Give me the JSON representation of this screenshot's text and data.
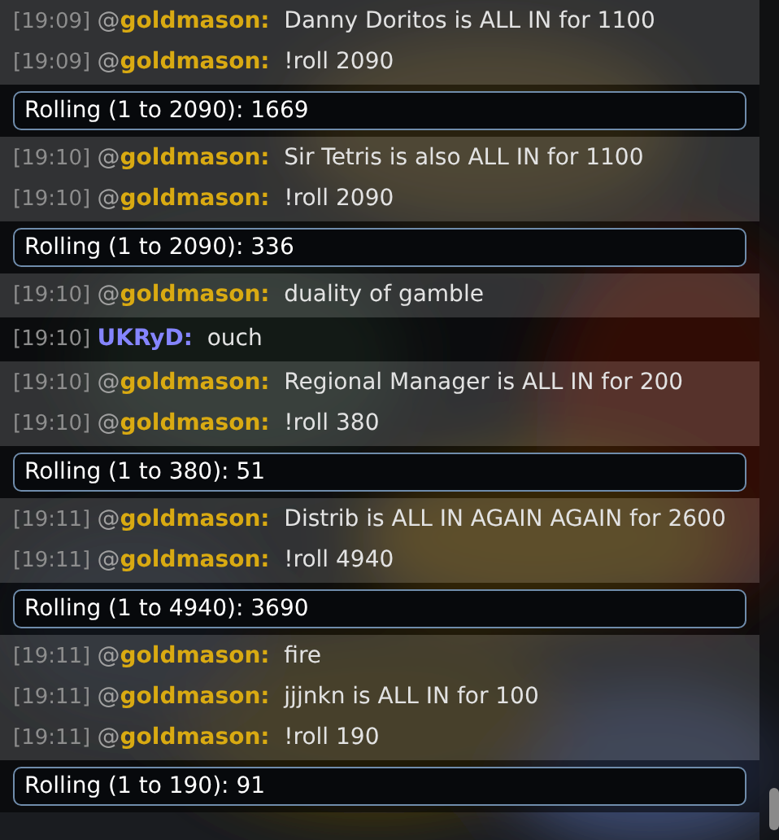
{
  "blocks": [
    {
      "kind": "group",
      "messages": [
        {
          "time": "[19:09]",
          "prefix": "@",
          "user": "goldmason:",
          "color": "#d9aa12",
          "text": "Danny Doritos is ALL IN for 1100"
        },
        {
          "time": "[19:09]",
          "prefix": "@",
          "user": "goldmason:",
          "color": "#d9aa12",
          "text": "!roll 2090"
        }
      ]
    },
    {
      "kind": "roll",
      "text": "Rolling (1 to 2090): 1669"
    },
    {
      "kind": "group",
      "messages": [
        {
          "time": "[19:10]",
          "prefix": "@",
          "user": "goldmason:",
          "color": "#d9aa12",
          "text": "Sir Tetris is also ALL IN for 1100"
        },
        {
          "time": "[19:10]",
          "prefix": "@",
          "user": "goldmason:",
          "color": "#d9aa12",
          "text": "!roll 2090"
        }
      ]
    },
    {
      "kind": "roll",
      "text": "Rolling (1 to 2090): 336"
    },
    {
      "kind": "group",
      "messages": [
        {
          "time": "[19:10]",
          "prefix": "@",
          "user": "goldmason:",
          "color": "#d9aa12",
          "text": "duality of gamble"
        }
      ]
    },
    {
      "kind": "solo",
      "messages": [
        {
          "time": "[19:10]",
          "user": "UKRyD:",
          "color": "#8585ff",
          "text": "ouch"
        }
      ]
    },
    {
      "kind": "group",
      "messages": [
        {
          "time": "[19:10]",
          "prefix": "@",
          "user": "goldmason:",
          "color": "#d9aa12",
          "text": "Regional Manager is ALL IN for 200"
        },
        {
          "time": "[19:10]",
          "prefix": "@",
          "user": "goldmason:",
          "color": "#d9aa12",
          "text": "!roll 380"
        }
      ]
    },
    {
      "kind": "roll",
      "text": "Rolling (1 to 380): 51"
    },
    {
      "kind": "group",
      "messages": [
        {
          "time": "[19:11]",
          "prefix": "@",
          "user": "goldmason:",
          "color": "#d9aa12",
          "text": "Distrib is ALL IN AGAIN AGAIN for 2600"
        },
        {
          "time": "[19:11]",
          "prefix": "@",
          "user": "goldmason:",
          "color": "#d9aa12",
          "text": "!roll 4940"
        }
      ]
    },
    {
      "kind": "roll",
      "text": "Rolling (1 to 4940): 3690"
    },
    {
      "kind": "group",
      "messages": [
        {
          "time": "[19:11]",
          "prefix": "@",
          "user": "goldmason:",
          "color": "#d9aa12",
          "text": "fire"
        },
        {
          "time": "[19:11]",
          "prefix": "@",
          "user": "goldmason:",
          "color": "#d9aa12",
          "text": "jjjnkn is ALL IN for 100"
        },
        {
          "time": "[19:11]",
          "prefix": "@",
          "user": "goldmason:",
          "color": "#d9aa12",
          "text": "!roll 190"
        }
      ]
    },
    {
      "kind": "roll",
      "text": "Rolling (1 to 190): 91"
    }
  ]
}
